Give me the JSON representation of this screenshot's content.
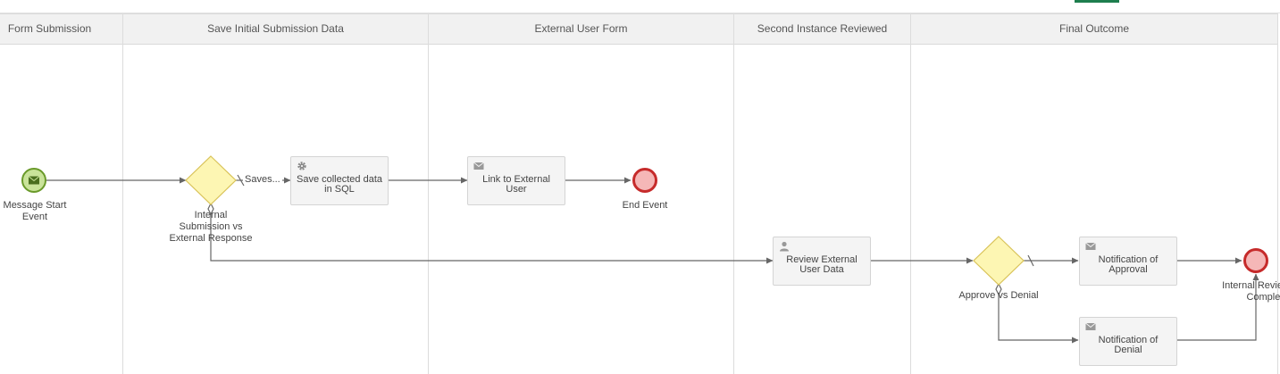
{
  "lanes": [
    {
      "title": "Form Submission"
    },
    {
      "title": "Save Initial Submission Data"
    },
    {
      "title": "External User Form"
    },
    {
      "title": "Second Instance Reviewed"
    },
    {
      "title": "Final Outcome"
    }
  ],
  "events": {
    "start": {
      "label_line1": "Message Start",
      "label_line2": "Event",
      "icon": "envelope-icon"
    },
    "end1": {
      "label": "End Event"
    },
    "end2": {
      "label_line1": "Internal Review",
      "label_line2": "Complete"
    }
  },
  "gateways": {
    "g1": {
      "label_line1": "Internal",
      "label_line2": "Submission vs",
      "label_line3": "External Response"
    },
    "g2": {
      "label": "Approve vs Denial"
    }
  },
  "tasks": {
    "save_sql": {
      "label": "Save collected data in SQL",
      "icon": "gear-icon"
    },
    "link_external": {
      "label": "Link to External User",
      "icon": "envelope-icon"
    },
    "review_external": {
      "label": "Review External User Data",
      "icon": "user-icon"
    },
    "notify_approval": {
      "label": "Notification of Approval",
      "icon": "envelope-icon"
    },
    "notify_denial": {
      "label": "Notification of Denial",
      "icon": "envelope-icon"
    }
  },
  "flows": {
    "saves_label": "Saves..."
  },
  "colors": {
    "start_fill": "#c9e39a",
    "start_stroke": "#6a9a2a",
    "end_fill": "#f5b7b7",
    "end_stroke": "#c62b2b",
    "gateway_fill": "#fdf6b3",
    "gateway_stroke": "#d9c35a",
    "flow_stroke": "#666666"
  }
}
